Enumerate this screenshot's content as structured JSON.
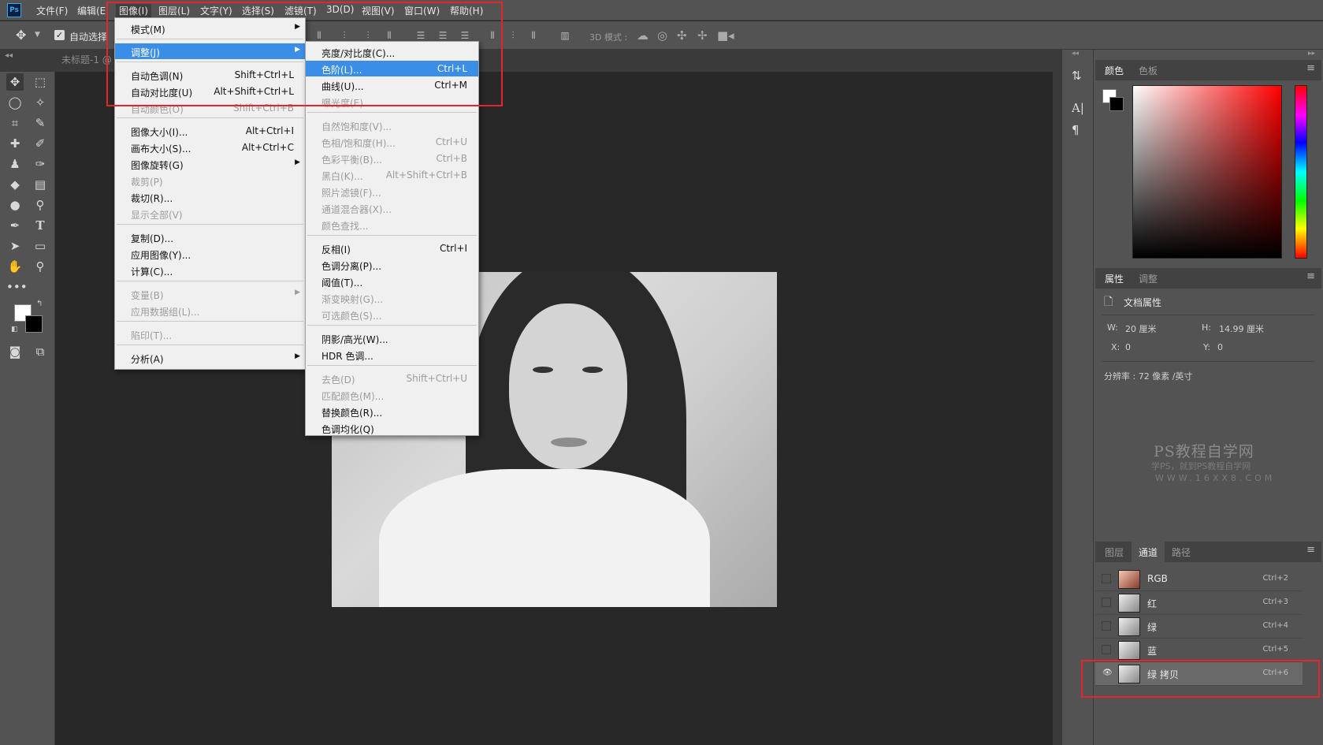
{
  "app": {
    "logo": "Ps"
  },
  "menubar": {
    "items": [
      "文件(F)",
      "编辑(E",
      "图像(I)",
      "图层(L)",
      "文字(Y)",
      "选择(S)",
      "滤镜(T)",
      "3D(D)",
      "视图(V)",
      "窗口(W)",
      "帮助(H)"
    ]
  },
  "options": {
    "autoselect_label": "自动选择",
    "mode3d_label": "3D 模式 :"
  },
  "document": {
    "tab_label": "未标题-1 @"
  },
  "image_menu": [
    {
      "label": "模式(M)",
      "shortcut": "",
      "submenu": true,
      "disabled": false
    },
    {
      "label": "调整(J)",
      "shortcut": "",
      "submenu": true,
      "disabled": false,
      "highlighted": true
    },
    {
      "label": "自动色调(N)",
      "shortcut": "Shift+Ctrl+L",
      "disabled": false
    },
    {
      "label": "自动对比度(U)",
      "shortcut": "Alt+Shift+Ctrl+L",
      "disabled": false
    },
    {
      "label": "自动颜色(O)",
      "shortcut": "Shift+Ctrl+B",
      "disabled": true
    },
    {
      "label": "图像大小(I)...",
      "shortcut": "Alt+Ctrl+I",
      "disabled": false
    },
    {
      "label": "画布大小(S)...",
      "shortcut": "Alt+Ctrl+C",
      "disabled": false
    },
    {
      "label": "图像旋转(G)",
      "shortcut": "",
      "submenu": true,
      "disabled": false
    },
    {
      "label": "裁剪(P)",
      "shortcut": "",
      "disabled": true
    },
    {
      "label": "裁切(R)...",
      "shortcut": "",
      "disabled": false
    },
    {
      "label": "显示全部(V)",
      "shortcut": "",
      "disabled": true
    },
    {
      "label": "复制(D)...",
      "shortcut": "",
      "disabled": false
    },
    {
      "label": "应用图像(Y)...",
      "shortcut": "",
      "disabled": false
    },
    {
      "label": "计算(C)...",
      "shortcut": "",
      "disabled": false
    },
    {
      "label": "变量(B)",
      "shortcut": "",
      "submenu": true,
      "disabled": true
    },
    {
      "label": "应用数据组(L)...",
      "shortcut": "",
      "disabled": true
    },
    {
      "label": "陷印(T)...",
      "shortcut": "",
      "disabled": true
    },
    {
      "label": "分析(A)",
      "shortcut": "",
      "submenu": true,
      "disabled": false
    }
  ],
  "adjust_menu": [
    {
      "label": "亮度/对比度(C)...",
      "shortcut": "",
      "disabled": false
    },
    {
      "label": "色阶(L)...",
      "shortcut": "Ctrl+L",
      "disabled": false,
      "highlighted": true
    },
    {
      "label": "曲线(U)...",
      "shortcut": "Ctrl+M",
      "disabled": false
    },
    {
      "label": "曝光度(E)...",
      "shortcut": "",
      "disabled": true
    },
    {
      "label": "自然饱和度(V)...",
      "shortcut": "",
      "disabled": true
    },
    {
      "label": "色相/饱和度(H)...",
      "shortcut": "Ctrl+U",
      "disabled": true
    },
    {
      "label": "色彩平衡(B)...",
      "shortcut": "Ctrl+B",
      "disabled": true
    },
    {
      "label": "黑白(K)...",
      "shortcut": "Alt+Shift+Ctrl+B",
      "disabled": true
    },
    {
      "label": "照片滤镜(F)...",
      "shortcut": "",
      "disabled": true
    },
    {
      "label": "通道混合器(X)...",
      "shortcut": "",
      "disabled": true
    },
    {
      "label": "颜色查找...",
      "shortcut": "",
      "disabled": true
    },
    {
      "label": "反相(I)",
      "shortcut": "Ctrl+I",
      "disabled": false
    },
    {
      "label": "色调分离(P)...",
      "shortcut": "",
      "disabled": false
    },
    {
      "label": "阈值(T)...",
      "shortcut": "",
      "disabled": false
    },
    {
      "label": "渐变映射(G)...",
      "shortcut": "",
      "disabled": true
    },
    {
      "label": "可选颜色(S)...",
      "shortcut": "",
      "disabled": true
    },
    {
      "label": "阴影/高光(W)...",
      "shortcut": "",
      "disabled": false
    },
    {
      "label": "HDR 色调...",
      "shortcut": "",
      "disabled": false
    },
    {
      "label": "去色(D)",
      "shortcut": "Shift+Ctrl+U",
      "disabled": true
    },
    {
      "label": "匹配颜色(M)...",
      "shortcut": "",
      "disabled": true
    },
    {
      "label": "替换颜色(R)...",
      "shortcut": "",
      "disabled": false
    },
    {
      "label": "色调均化(Q)",
      "shortcut": "",
      "disabled": false
    }
  ],
  "color_panel": {
    "tabs": [
      "颜色",
      "色板"
    ]
  },
  "properties_panel": {
    "tabs": [
      "属性",
      "调整"
    ],
    "title": "文档属性",
    "w_label": "W:",
    "w_value": "20 厘米",
    "h_label": "H:",
    "h_value": "14.99 厘米",
    "x_label": "X:",
    "x_value": "0",
    "y_label": "Y:",
    "y_value": "0",
    "resolution": "分辨率 : 72 像素 /英寸"
  },
  "watermark": {
    "title": "PS教程自学网",
    "subtitle": "学PS，就到PS教程自学网",
    "url": "WWW.16XX8.COM"
  },
  "channels_panel": {
    "tabs": [
      "图层",
      "通道",
      "路径"
    ],
    "channels": [
      {
        "name": "RGB",
        "shortcut": "Ctrl+2",
        "visible": false
      },
      {
        "name": "红",
        "shortcut": "Ctrl+3",
        "visible": false
      },
      {
        "name": "绿",
        "shortcut": "Ctrl+4",
        "visible": false
      },
      {
        "name": "蓝",
        "shortcut": "Ctrl+5",
        "visible": false
      },
      {
        "name": "绿 拷贝",
        "shortcut": "Ctrl+6",
        "visible": true,
        "selected": true
      }
    ]
  },
  "colors": {
    "highlight_blue": "#3b8ee8",
    "annotation_red": "#e3262b"
  }
}
